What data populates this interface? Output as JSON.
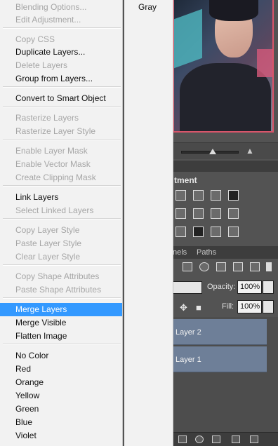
{
  "menu": {
    "items": [
      {
        "label": "Blending Options...",
        "enabled": false
      },
      {
        "label": "Edit Adjustment...",
        "enabled": false
      },
      {
        "label": "Copy CSS",
        "enabled": false
      },
      {
        "label": "Duplicate Layers...",
        "enabled": true
      },
      {
        "label": "Delete Layers",
        "enabled": false
      },
      {
        "label": "Group from Layers...",
        "enabled": true
      },
      {
        "label": "Convert to Smart Object",
        "enabled": true
      },
      {
        "label": "Rasterize Layers",
        "enabled": false
      },
      {
        "label": "Rasterize Layer Style",
        "enabled": false
      },
      {
        "label": "Enable Layer Mask",
        "enabled": false
      },
      {
        "label": "Enable Vector Mask",
        "enabled": false
      },
      {
        "label": "Create Clipping Mask",
        "enabled": false
      },
      {
        "label": "Link Layers",
        "enabled": true
      },
      {
        "label": "Select Linked Layers",
        "enabled": false
      },
      {
        "label": "Copy Layer Style",
        "enabled": false
      },
      {
        "label": "Paste Layer Style",
        "enabled": false
      },
      {
        "label": "Clear Layer Style",
        "enabled": false
      },
      {
        "label": "Copy Shape Attributes",
        "enabled": false
      },
      {
        "label": "Paste Shape Attributes",
        "enabled": false
      },
      {
        "label": "Merge Layers",
        "enabled": true,
        "highlighted": true
      },
      {
        "label": "Merge Visible",
        "enabled": true
      },
      {
        "label": "Flatten Image",
        "enabled": true
      },
      {
        "label": "No Color",
        "enabled": true
      },
      {
        "label": "Red",
        "enabled": true
      },
      {
        "label": "Orange",
        "enabled": true
      },
      {
        "label": "Yellow",
        "enabled": true
      },
      {
        "label": "Green",
        "enabled": true
      },
      {
        "label": "Blue",
        "enabled": true
      },
      {
        "label": "Violet",
        "enabled": true
      }
    ]
  },
  "submenu": {
    "label": "Gray"
  },
  "panels": {
    "adjustments_title": "tment",
    "layers_tabs": [
      "nels",
      "Paths"
    ],
    "opacity_label": "Opacity:",
    "opacity_value": "100%",
    "fill_label": "Fill:",
    "fill_value": "100%",
    "layers": [
      "Layer 2",
      "Layer 1"
    ]
  },
  "colors": {
    "highlight": "#3399ff",
    "layer_selected": "#6e7f98",
    "panel_bg": "#535353"
  }
}
